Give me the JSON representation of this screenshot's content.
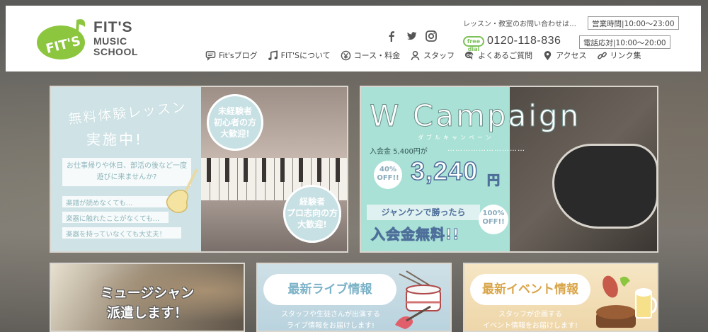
{
  "header": {
    "logo": {
      "badge_text": "FIT'S",
      "line1": "FIT'S",
      "line2": "MUSIC",
      "line3": "SCHOOL"
    },
    "contact_label": "レッスン・教室のお問い合わせは…",
    "hours": {
      "label": "営業時間",
      "value": "10:00～23:00"
    },
    "phone": {
      "number": "0120-118-836",
      "label": "電話応対",
      "value": "10:00～20:00"
    },
    "free_dial_mark": "free dial",
    "social": [
      {
        "icon": "facebook-icon"
      },
      {
        "icon": "twitter-icon"
      },
      {
        "icon": "instagram-icon"
      }
    ],
    "nav": [
      {
        "label": "Fit'sブログ",
        "icon": "speech-bubble-icon"
      },
      {
        "label": "FIT'Sについて",
        "icon": "music-note-icon"
      },
      {
        "label": "コース・料金",
        "icon": "yen-icon"
      },
      {
        "label": "スタッフ",
        "icon": "person-icon"
      },
      {
        "label": "よくあるご質問",
        "icon": "qa-icon"
      },
      {
        "label": "アクセス",
        "icon": "map-pin-icon"
      },
      {
        "label": "リンク集",
        "icon": "link-icon"
      }
    ]
  },
  "banner_trial": {
    "title": "無料体験レッスン",
    "subtitle": "実施中!",
    "note": "お仕事帰りや休日、部活の後など一度遊びに来ませんか?",
    "lines": [
      "楽譜が読めなくても…",
      "楽器に触れたことがなくても…",
      "楽器を持っていなくても大丈夫！"
    ],
    "bubble1": [
      "未経験者",
      "初心者の方",
      "大歓迎!"
    ],
    "bubble2": [
      "経験者",
      "プロ志向の方",
      "大歓迎!"
    ]
  },
  "banner_campaign": {
    "title": "W Campaign",
    "kana": "ダブルキャンペーン",
    "fee_label": "入会金 5,400円が",
    "dots": "…………………………",
    "off40": [
      "40%",
      "OFF!!"
    ],
    "price": "3,240",
    "yen": "円",
    "janken": "ジャンケンで勝ったら",
    "free": "入会金無料!!",
    "off100": [
      "100%",
      "OFF!!"
    ]
  },
  "banner_musician": {
    "line1": "ミュージシャン",
    "line2": "派遣します！"
  },
  "banner_live": {
    "title": "最新ライブ情報",
    "sub": [
      "スタッフや生徒さんが出演する",
      "ライブ情報をお届けします!"
    ]
  },
  "banner_event": {
    "title": "最新イベント情報",
    "sub": [
      "スタッフが企画する",
      "イベント情報をお届けします!"
    ]
  },
  "colors": {
    "brand_green": "#8cc63f",
    "text_gray": "#444444",
    "campaign_teal": "#a9e1d6",
    "trial_blue": "#cfe3e6"
  }
}
